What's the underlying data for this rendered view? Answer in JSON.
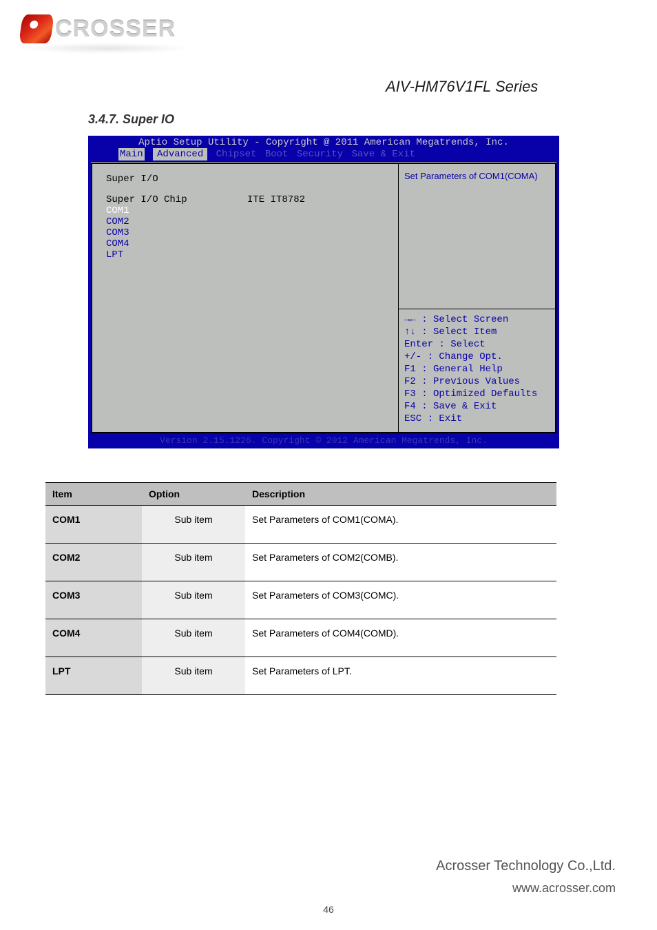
{
  "header": {
    "model": "AIV-HM76V1FL Series",
    "logo_text": "CROSSER"
  },
  "section": {
    "heading": "3.4.7. Super IO"
  },
  "bios": {
    "title": "Aptio Setup Utility - Copyright @ 2011 American Megatrends, Inc.",
    "menu": [
      "Main",
      "Advanced",
      "Chipset",
      "Boot",
      "Security",
      "Save & Exit"
    ],
    "active_menu_index": 1,
    "left": {
      "header": "Super I/O",
      "chip_row": {
        "label": "Super I/O Chip",
        "value": "ITE IT8782"
      },
      "items": [
        "COM1",
        "COM2",
        "COM3",
        "COM4",
        "LPT"
      ]
    },
    "right": {
      "help_text": "Set Parameters of COM1(COMA)",
      "keys": [
        "→← : Select Screen",
        "↑↓ : Select Item",
        "Enter : Select",
        "+/- : Change Opt.",
        "F1 : General Help",
        "F2 : Previous Values",
        "F3 : Optimized Defaults",
        "F4 : Save & Exit",
        "ESC : Exit"
      ]
    },
    "footer": "Version 2.15.1226. Copyright © 2012 American Megatrends, Inc."
  },
  "table": {
    "headers": [
      "Item",
      "Option",
      "Description"
    ],
    "rows": [
      {
        "item": "COM1",
        "option": "Sub item",
        "description": "Set Parameters of COM1(COMA)."
      },
      {
        "item": "COM2",
        "option": "Sub item",
        "description": "Set Parameters of COM2(COMB)."
      },
      {
        "item": "COM3",
        "option": "Sub item",
        "description": "Set Parameters of COM3(COMC)."
      },
      {
        "item": "COM4",
        "option": "Sub item",
        "description": "Set Parameters of COM4(COMD)."
      },
      {
        "item": "LPT",
        "option": "Sub item",
        "description": "Set Parameters of LPT."
      }
    ]
  },
  "footer": {
    "company": "Acrosser Technology Co.,Ltd.",
    "site": "www.acrosser.com",
    "page_number": "46"
  }
}
